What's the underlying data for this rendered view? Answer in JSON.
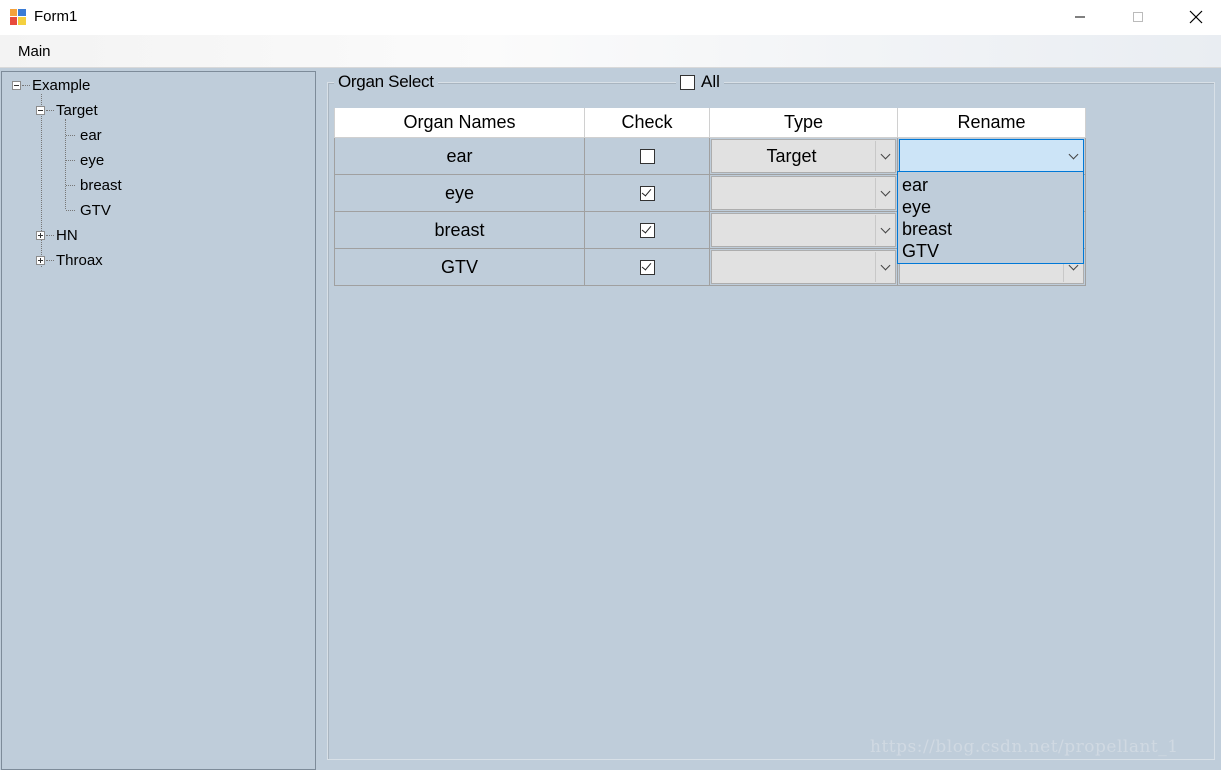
{
  "window": {
    "title": "Form1"
  },
  "menu": {
    "items": [
      "Main"
    ]
  },
  "tree": {
    "root": "Example",
    "nodes": [
      {
        "label": "Target",
        "expanded": true,
        "children": [
          "ear",
          "eye",
          "breast",
          "GTV"
        ]
      },
      {
        "label": "HN",
        "expanded": false
      },
      {
        "label": "Throax",
        "expanded": false
      }
    ]
  },
  "organ_select": {
    "legend": "Organ Select",
    "all_label": "All",
    "all_checked": false
  },
  "grid": {
    "headers": [
      "Organ Names",
      "Check",
      "Type",
      "Rename"
    ],
    "rows": [
      {
        "name": "ear",
        "checked": false,
        "type": "Target",
        "rename": ""
      },
      {
        "name": "eye",
        "checked": true,
        "type": "",
        "rename": ""
      },
      {
        "name": "breast",
        "checked": true,
        "type": "",
        "rename": ""
      },
      {
        "name": "GTV",
        "checked": true,
        "type": "",
        "rename": ""
      }
    ]
  },
  "rename_dropdown": {
    "options": [
      "ear",
      "eye",
      "breast",
      "GTV"
    ]
  },
  "watermark": "https://blog.csdn.net/propellant_1"
}
